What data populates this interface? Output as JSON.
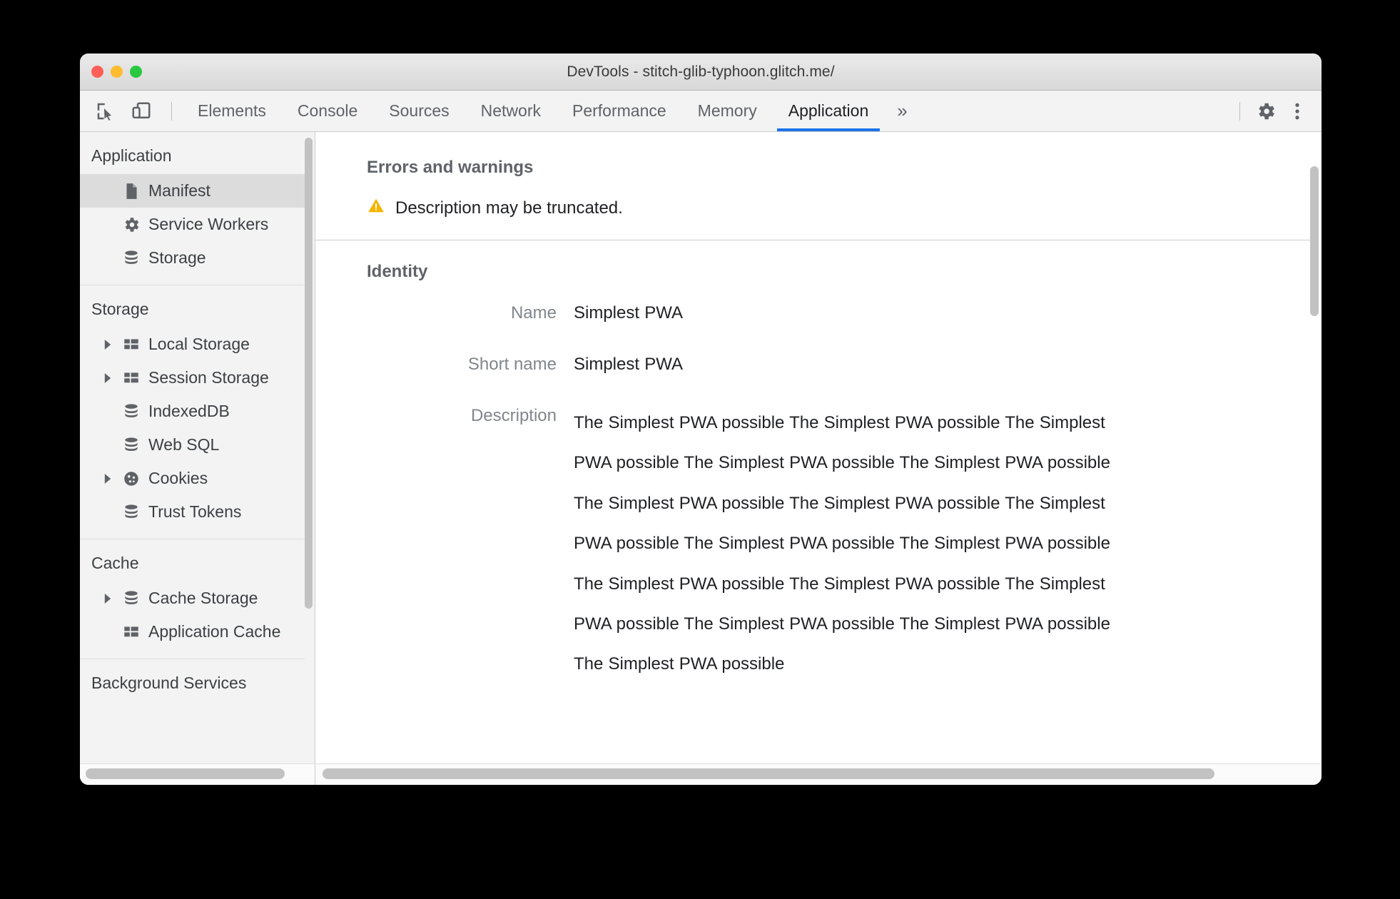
{
  "window": {
    "title": "DevTools - stitch-glib-typhoon.glitch.me/"
  },
  "toolbar": {
    "inspect_icon": "inspect-element-icon",
    "device_icon": "device-toolbar-icon",
    "settings_icon": "gear-icon",
    "more_icon": "more-vertical-icon",
    "more_tabs_label": "»",
    "accent_color": "#1a73e8"
  },
  "tabs": [
    {
      "label": "Elements",
      "active": false
    },
    {
      "label": "Console",
      "active": false
    },
    {
      "label": "Sources",
      "active": false
    },
    {
      "label": "Network",
      "active": false
    },
    {
      "label": "Performance",
      "active": false
    },
    {
      "label": "Memory",
      "active": false
    },
    {
      "label": "Application",
      "active": true
    }
  ],
  "sidebar": {
    "sections": [
      {
        "header": "Application",
        "items": [
          {
            "label": "Manifest",
            "icon": "document-icon",
            "selected": true,
            "expandable": false
          },
          {
            "label": "Service Workers",
            "icon": "gear-icon",
            "selected": false,
            "expandable": false
          },
          {
            "label": "Storage",
            "icon": "database-icon",
            "selected": false,
            "expandable": false
          }
        ]
      },
      {
        "header": "Storage",
        "items": [
          {
            "label": "Local Storage",
            "icon": "table-icon",
            "selected": false,
            "expandable": true
          },
          {
            "label": "Session Storage",
            "icon": "table-icon",
            "selected": false,
            "expandable": true
          },
          {
            "label": "IndexedDB",
            "icon": "database-icon",
            "selected": false,
            "expandable": false
          },
          {
            "label": "Web SQL",
            "icon": "database-icon",
            "selected": false,
            "expandable": false
          },
          {
            "label": "Cookies",
            "icon": "cookie-icon",
            "selected": false,
            "expandable": true
          },
          {
            "label": "Trust Tokens",
            "icon": "database-icon",
            "selected": false,
            "expandable": false
          }
        ]
      },
      {
        "header": "Cache",
        "items": [
          {
            "label": "Cache Storage",
            "icon": "database-icon",
            "selected": false,
            "expandable": true
          },
          {
            "label": "Application Cache",
            "icon": "table-icon",
            "selected": false,
            "expandable": false
          }
        ]
      },
      {
        "header": "Background Services",
        "items": []
      }
    ]
  },
  "main": {
    "errors_section": {
      "title": "Errors and warnings",
      "warning_icon": "warning-triangle-icon",
      "warning_color": "#f5b400",
      "messages": [
        "Description may be truncated."
      ]
    },
    "identity_section": {
      "title": "Identity",
      "fields": [
        {
          "label": "Name",
          "value": "Simplest PWA"
        },
        {
          "label": "Short name",
          "value": "Simplest PWA"
        },
        {
          "label": "Description",
          "value": "The Simplest PWA possible The Simplest PWA possible The Simplest PWA possible The Simplest PWA possible The Simplest PWA possible The Simplest PWA possible The Simplest PWA possible The Simplest PWA possible The Simplest PWA possible The Simplest PWA possible The Simplest PWA possible The Simplest PWA possible The Simplest PWA possible The Simplest PWA possible The Simplest PWA possible The Simplest PWA possible"
        }
      ]
    }
  }
}
